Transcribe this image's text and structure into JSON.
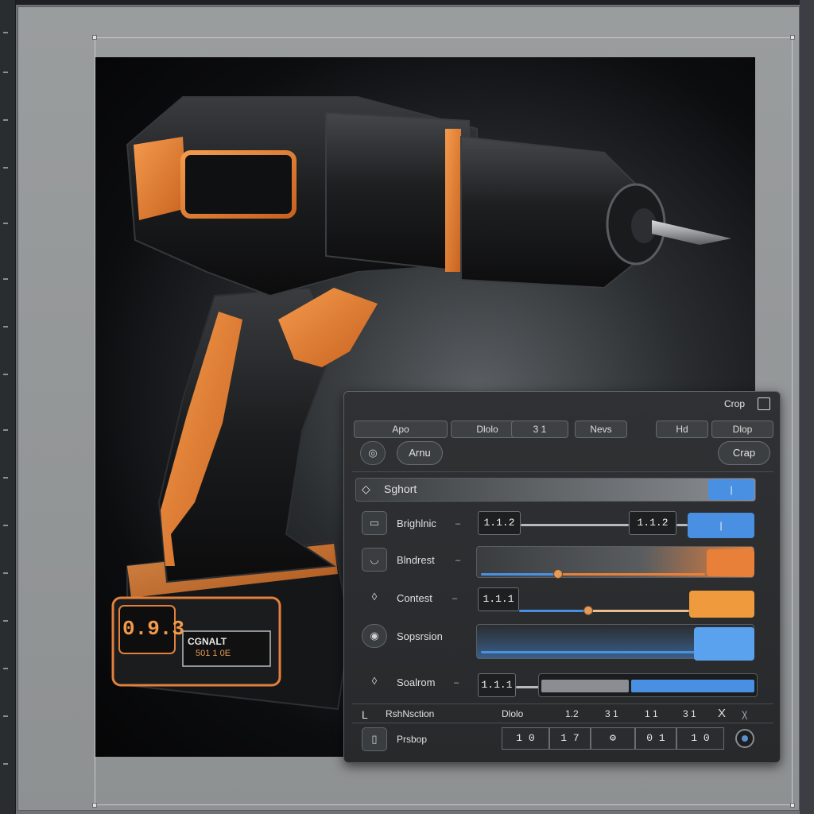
{
  "panel": {
    "title": "Crop",
    "tabs": [
      "Apo",
      "Dlolo",
      "3 1",
      "Nevs",
      "Hd",
      "Dlop"
    ],
    "row1": {
      "left_button": "Arnu",
      "right_button": "Crap"
    },
    "section": {
      "label": "Sghort"
    },
    "sliders": [
      {
        "name": "brightness",
        "label": "Brighlnic",
        "value_left": "1.1.2",
        "value_right": "1.1.2",
        "fill_color": "#4a90e2",
        "level": 0.88
      },
      {
        "name": "blindrest",
        "label": "Blndrest",
        "fill_color": "#e8803a",
        "level": 0.26
      },
      {
        "name": "contrast",
        "label": "Contest",
        "value_left": "1.1.1",
        "fill_color": "#f09a3e",
        "level": 0.38
      },
      {
        "name": "saturation",
        "label": "Sopsrsion",
        "fill_color": "#4a90e2",
        "level": 0.92
      },
      {
        "name": "shadows",
        "label": "Soalrom",
        "value_left": "1.1.1",
        "fill_color": "#4a90e2",
        "level": 0.42
      }
    ],
    "footer_header": {
      "letter": "L",
      "label": "RshNsction",
      "items": [
        "Dlolo",
        "1.2",
        "3 1",
        "1 1",
        "3 1",
        "X",
        "χ"
      ]
    },
    "footer": {
      "label": "Prsbop",
      "buttons": [
        "1 0",
        "1 7",
        "⚙",
        "0 1",
        "1 0"
      ]
    }
  },
  "product": {
    "battery_number": "0.9.3",
    "battery_label_line1": "CGNALT",
    "battery_label_line2": "501 1 0E"
  },
  "colors": {
    "accent_orange": "#e8803a",
    "accent_blue": "#4a90e2",
    "panel_bg": "#2b2d30"
  }
}
